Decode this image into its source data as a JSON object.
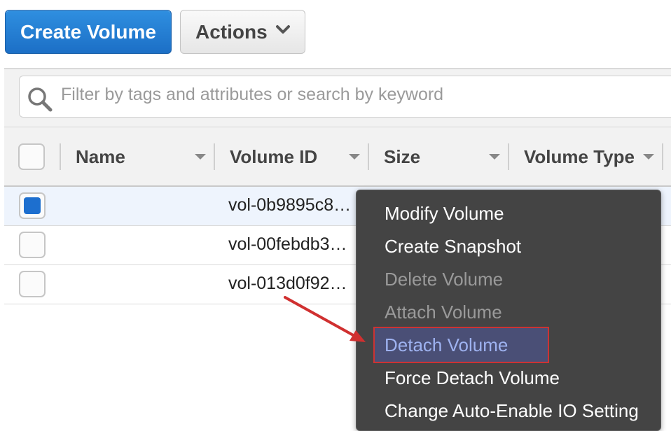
{
  "toolbar": {
    "create_label": "Create Volume",
    "actions_label": "Actions"
  },
  "search": {
    "placeholder": "Filter by tags and attributes or search by keyword"
  },
  "table": {
    "columns": [
      "Name",
      "Volume ID",
      "Size",
      "Volume Type"
    ],
    "rows": [
      {
        "name": "",
        "volume_id": "vol-0b9895c8…",
        "selected": true
      },
      {
        "name": "",
        "volume_id": "vol-00febdb3…",
        "selected": false
      },
      {
        "name": "",
        "volume_id": "vol-013d0f92…",
        "selected": false
      }
    ]
  },
  "menu": {
    "items": [
      {
        "label": "Modify Volume",
        "state": "enabled"
      },
      {
        "label": "Create Snapshot",
        "state": "enabled"
      },
      {
        "label": "Delete Volume",
        "state": "disabled"
      },
      {
        "label": "Attach Volume",
        "state": "disabled"
      },
      {
        "label": "Detach Volume",
        "state": "highlighted"
      },
      {
        "label": "Force Detach Volume",
        "state": "enabled"
      },
      {
        "label": "Change Auto-Enable IO Setting",
        "state": "enabled"
      }
    ]
  },
  "colors": {
    "primary": "#1c6fc6",
    "menu_bg": "#444444",
    "highlight_border": "#cc3333",
    "annotation_arrow": "#d03030"
  },
  "icons": {
    "search": "magnifier-icon",
    "actions_dropdown": "chevron-down-icon",
    "sort": "sort-caret-icon",
    "annotation": "arrow-annotation-icon"
  }
}
